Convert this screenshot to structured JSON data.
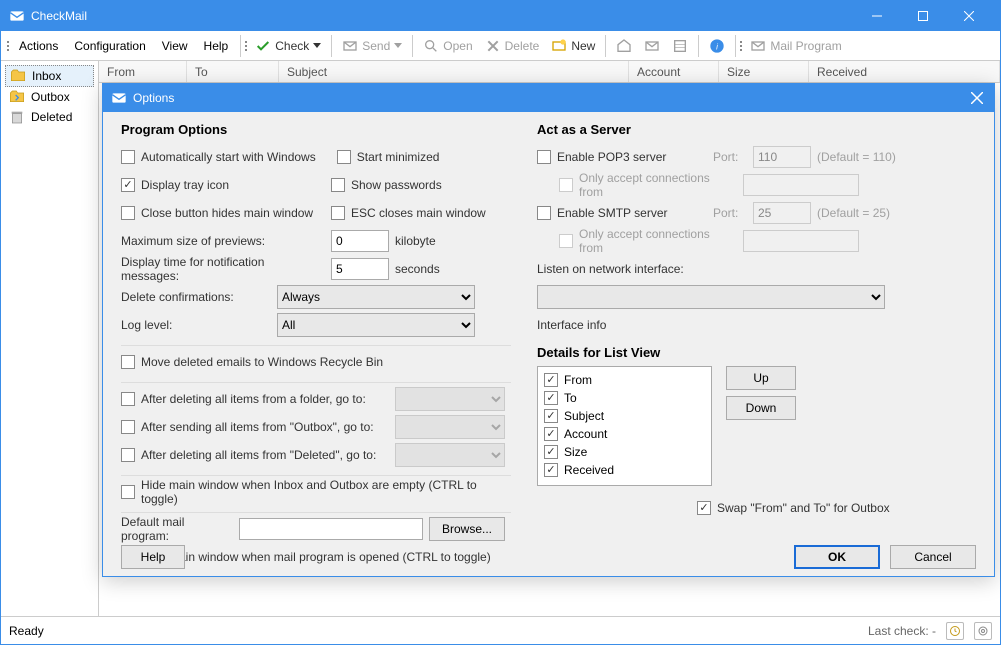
{
  "window": {
    "title": "CheckMail"
  },
  "menu": {
    "actions": "Actions",
    "configuration": "Configuration",
    "view": "View",
    "help": "Help"
  },
  "toolbar": {
    "check": "Check",
    "send": "Send",
    "open": "Open",
    "delete": "Delete",
    "new": "New",
    "mail_program": "Mail Program"
  },
  "sidebar": {
    "inbox": "Inbox",
    "outbox": "Outbox",
    "deleted": "Deleted"
  },
  "columns": {
    "from": "From",
    "to": "To",
    "subject": "Subject",
    "account": "Account",
    "size": "Size",
    "received": "Received"
  },
  "status": {
    "ready": "Ready",
    "last_check": "Last check: -"
  },
  "dialog": {
    "title": "Options",
    "program_options": "Program Options",
    "auto_start": "Automatically start with Windows",
    "start_minimized": "Start minimized",
    "display_tray": "Display tray icon",
    "show_passwords": "Show passwords",
    "close_hides": "Close button hides main window",
    "esc_closes": "ESC closes main window",
    "max_previews": "Maximum size of previews:",
    "max_previews_value": "0",
    "kilobyte": "kilobyte",
    "notif_time": "Display time for notification messages:",
    "notif_time_value": "5",
    "seconds": "seconds",
    "delete_confirm": "Delete confirmations:",
    "delete_confirm_value": "Always",
    "log_level": "Log level:",
    "log_level_value": "All",
    "move_deleted": "Move deleted emails to Windows Recycle Bin",
    "after_delete_folder": "After deleting all items from a folder, go to:",
    "after_send_outbox": "After sending all items from \"Outbox\", go to:",
    "after_delete_deleted": "After deleting all items from \"Deleted\", go to:",
    "hide_when_empty": "Hide main window when Inbox and Outbox are empty (CTRL to toggle)",
    "default_mail_program": "Default mail program:",
    "browse": "Browse...",
    "hide_when_opened": "Hide main window when mail program is opened (CTRL to toggle)",
    "help": "Help",
    "ok": "OK",
    "cancel": "Cancel",
    "server_title": "Act as a Server",
    "enable_pop3": "Enable POP3 server",
    "port": "Port:",
    "pop3_port": "110",
    "pop3_default": "(Default = 110)",
    "only_accept": "Only accept connections from",
    "enable_smtp": "Enable SMTP server",
    "smtp_port": "25",
    "smtp_default": "(Default = 25)",
    "listen_interface": "Listen on network interface:",
    "interface_info": "Interface info",
    "details_title": "Details for List View",
    "up": "Up",
    "down": "Down",
    "swap": "Swap \"From\" and To\" for Outbox",
    "list": {
      "from": "From",
      "to": "To",
      "subject": "Subject",
      "account": "Account",
      "size": "Size",
      "received": "Received"
    }
  }
}
